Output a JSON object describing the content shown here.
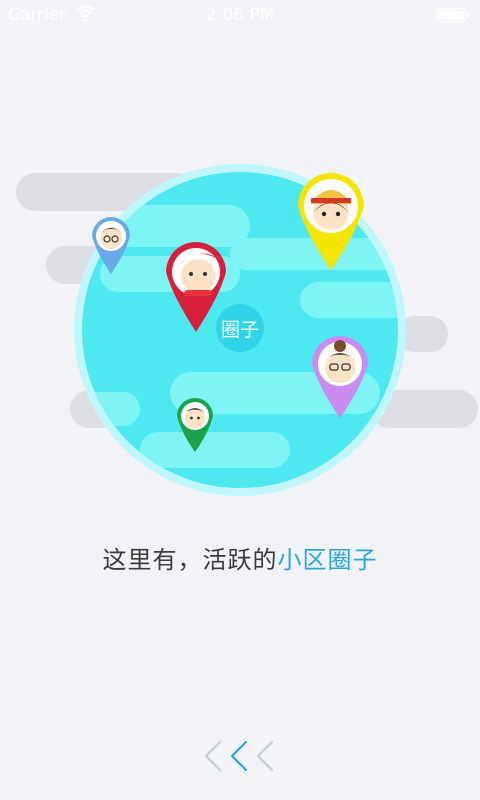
{
  "status_bar": {
    "carrier": "Carrier",
    "time": "2:06 PM",
    "icons": [
      "wifi-icon",
      "battery-icon"
    ]
  },
  "illustration": {
    "globe_badge": "圈子",
    "pins": [
      {
        "name": "pin-blue",
        "color": "#6aa9e8"
      },
      {
        "name": "pin-red",
        "color": "#d61f3a"
      },
      {
        "name": "pin-yellow",
        "color": "#f4e400"
      },
      {
        "name": "pin-purple",
        "color": "#c98bf0"
      },
      {
        "name": "pin-green",
        "color": "#1aa34a"
      }
    ],
    "colors": {
      "globe": "#4de8f0",
      "globe_rim": "#bff6fb",
      "land": "#7ff4f4",
      "clouds": "#dcdee3"
    }
  },
  "caption": {
    "prefix": "这里有，活跃的",
    "highlight": "小区圈子"
  },
  "pager": {
    "icons": [
      "chevron-left-icon",
      "chevron-left-icon",
      "chevron-left-icon"
    ],
    "active_color": "#27a6dc"
  }
}
